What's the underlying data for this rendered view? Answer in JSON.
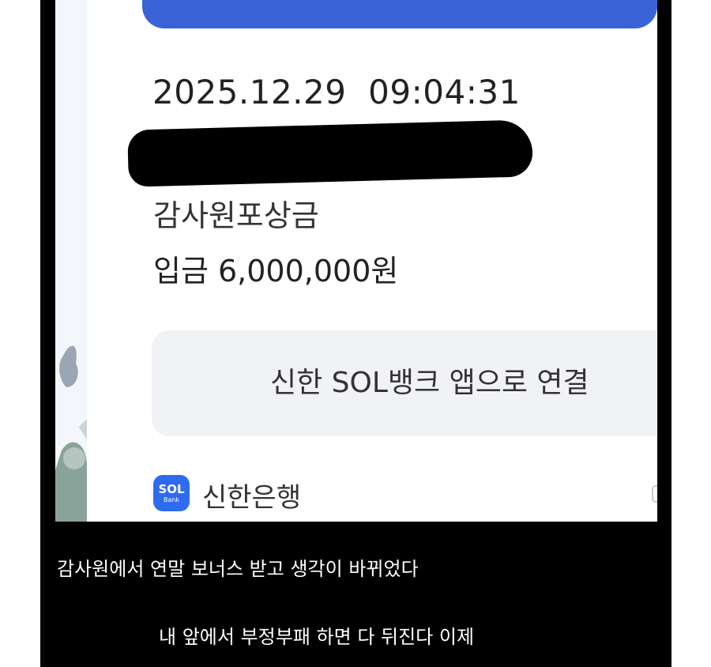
{
  "notification": {
    "timestamp": "2025.12.29  09:04:31",
    "memo": "감사원포상금",
    "amount": "입금 6,000,000원",
    "connect_button_label": "신한 SOL뱅크 앱으로 연결",
    "bank_logo_text": "SOL",
    "bank_logo_subtext": "Bank",
    "bank_name": "신한은행"
  },
  "captions": {
    "line1": "감사원에서 연말 보너스 받고 생각이 바뀌었다",
    "line2": "내 앞에서 부정부패 하면 다 뒤진다 이제"
  },
  "colors": {
    "banner_blue": "#3a63d8",
    "logo_blue": "#2f6bef",
    "button_gray": "#f1f2f5",
    "background_black": "#000000"
  },
  "icons": [
    "sol-bank-logo-icon",
    "chat-bubble-icon"
  ]
}
